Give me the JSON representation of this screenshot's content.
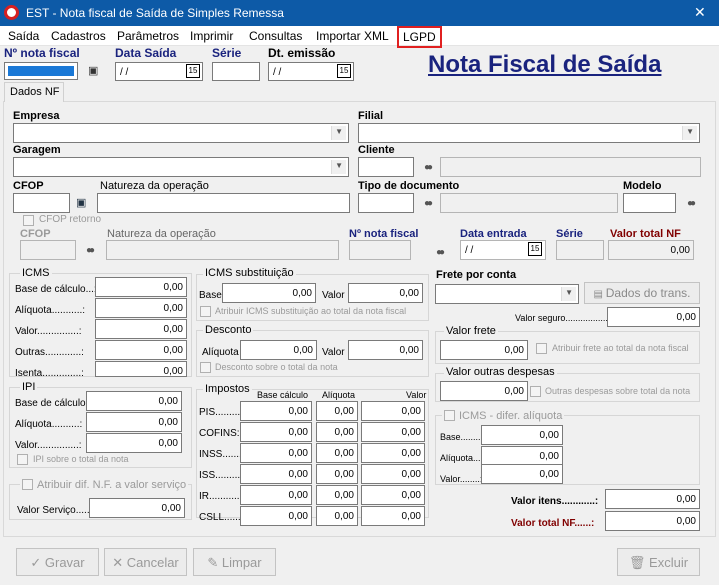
{
  "window": {
    "title": "EST - Nota fiscal de Saída de Simples Remessa",
    "close": "✕"
  },
  "menu": [
    "Saída",
    "Cadastros",
    "Parâmetros",
    "Imprimir",
    "Consultas",
    "Importar XML",
    "LGPD"
  ],
  "header": {
    "nota_fiscal": "Nº nota fiscal",
    "data_saida": "Data Saída",
    "serie": "Série",
    "dt_emissao": "Dt. emissão",
    "date_empty": "/ /",
    "page_title": "Nota Fiscal de Saída"
  },
  "tab": "Dados NF",
  "fields": {
    "empresa": "Empresa",
    "filial": "Filial",
    "garagem": "Garagem",
    "cliente": "Cliente",
    "cfop": "CFOP",
    "natureza": "Natureza da operação",
    "tipo_doc": "Tipo de documento",
    "modelo": "Modelo",
    "cfop_retorno": "CFOP retorno",
    "cfop2": "CFOP",
    "natureza2": "Natureza da operação",
    "nota_fiscal2": "Nº nota fiscal",
    "data_entrada": "Data entrada",
    "serie2": "Série",
    "valor_total_nf": "Valor total NF",
    "valor_total_nf_value": "0,00"
  },
  "icms": {
    "title": "ICMS",
    "rows": [
      {
        "label": "Base de cálculo...:",
        "value": "0,00"
      },
      {
        "label": "Alíquota...........:",
        "value": "0,00"
      },
      {
        "label": "Valor...............:",
        "value": "0,00"
      },
      {
        "label": "Outras.............:",
        "value": "0,00"
      },
      {
        "label": "Isenta..............:",
        "value": "0,00"
      }
    ]
  },
  "ipi": {
    "title": "IPI",
    "rows": [
      {
        "label": "Base de cálculo.:",
        "value": "0,00"
      },
      {
        "label": "Alíquota..........:",
        "value": "0,00"
      },
      {
        "label": "Valor...............:",
        "value": "0,00"
      }
    ],
    "check": "IPI sobre o total da nota"
  },
  "valor_servico": {
    "check": "Atribuir dif. N.F. a valor serviço",
    "label": "Valor Serviço.......:",
    "value": "0,00"
  },
  "icms_st": {
    "title": "ICMS substituição",
    "base": "Base",
    "base_value": "0,00",
    "valor": "Valor",
    "valor_value": "0,00",
    "check": "Atribuir ICMS substituição ao total da nota fiscal"
  },
  "desconto": {
    "title": "Desconto",
    "aliquota": "Alíquota",
    "aliquota_value": "0,00",
    "valor": "Valor",
    "valor_value": "0,00",
    "check": "Desconto sobre o total da nota"
  },
  "impostos": {
    "title": "Impostos",
    "headers": [
      "Base cálculo",
      "Alíquota",
      "Valor"
    ],
    "rows": [
      {
        "label": "PIS.........:",
        "values": [
          "0,00",
          "0,00",
          "0,00"
        ]
      },
      {
        "label": "COFINS:",
        "values": [
          "0,00",
          "0,00",
          "0,00"
        ]
      },
      {
        "label": "INSS........:",
        "values": [
          "0,00",
          "0,00",
          "0,00"
        ]
      },
      {
        "label": "ISS.........:",
        "values": [
          "0,00",
          "0,00",
          "0,00"
        ]
      },
      {
        "label": "IR...........:",
        "values": [
          "0,00",
          "0,00",
          "0,00"
        ]
      },
      {
        "label": "CSLL........:",
        "values": [
          "0,00",
          "0,00",
          "0,00"
        ]
      }
    ]
  },
  "frete": {
    "label": "Frete por conta",
    "button": "Dados do trans.",
    "valor_seguro": "Valor seguro.................:",
    "valor_seguro_value": "0,00"
  },
  "valor_frete": {
    "title": "Valor frete",
    "value": "0,00",
    "check": "Atribuir frete ao total da nota fiscal"
  },
  "outras": {
    "title": "Valor outras despesas",
    "value": "0,00",
    "check": "Outras despesas sobre total da nota"
  },
  "icms_difer": {
    "title": "ICMS - difer. alíquota",
    "rows": [
      {
        "label": "Base........:",
        "value": "0,00"
      },
      {
        "label": "Alíquota....:",
        "value": "0,00"
      },
      {
        "label": "Valor........:",
        "value": "0,00"
      }
    ]
  },
  "totals": {
    "itens_label": "Valor itens............:",
    "itens_value": "0,00",
    "nf_label": "Valor total NF......:",
    "nf_value": "0,00"
  },
  "buttons": {
    "gravar": "Gravar",
    "cancelar": "Cancelar",
    "limpar": "Limpar",
    "excluir": "Excluir"
  }
}
